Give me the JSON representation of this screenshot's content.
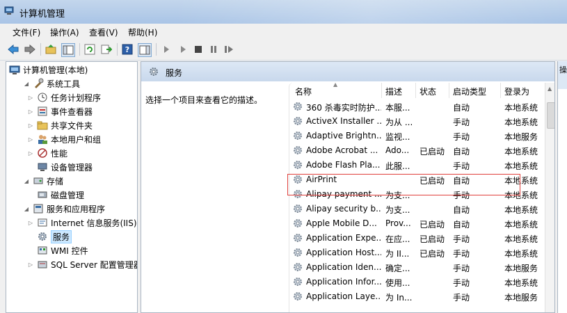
{
  "window": {
    "title": "计算机管理"
  },
  "menu": [
    "文件(F)",
    "操作(A)",
    "查看(V)",
    "帮助(H)"
  ],
  "tree": [
    {
      "label": "计算机管理(本地)",
      "level": 0,
      "expander": ""
    },
    {
      "label": "系统工具",
      "level": 1,
      "expander": "◢"
    },
    {
      "label": "任务计划程序",
      "level": 2,
      "expander": "▷"
    },
    {
      "label": "事件查看器",
      "level": 2,
      "expander": "▷"
    },
    {
      "label": "共享文件夹",
      "level": 2,
      "expander": "▷"
    },
    {
      "label": "本地用户和组",
      "level": 2,
      "expander": "▷"
    },
    {
      "label": "性能",
      "level": 2,
      "expander": "▷"
    },
    {
      "label": "设备管理器",
      "level": 2,
      "expander": ""
    },
    {
      "label": "存储",
      "level": 1,
      "expander": "◢"
    },
    {
      "label": "磁盘管理",
      "level": 2,
      "expander": ""
    },
    {
      "label": "服务和应用程序",
      "level": 1,
      "expander": "◢"
    },
    {
      "label": "Internet 信息服务(IIS)管",
      "level": 2,
      "expander": "▷"
    },
    {
      "label": "服务",
      "level": 2,
      "expander": "",
      "selected": true
    },
    {
      "label": "WMI 控件",
      "level": 2,
      "expander": ""
    },
    {
      "label": "SQL Server 配置管理器",
      "level": 2,
      "expander": "▷"
    }
  ],
  "main": {
    "header_title": "服务",
    "description": "选择一个项目来查看它的描述。",
    "columns": [
      "名称",
      "描述",
      "状态",
      "启动类型",
      "登录为"
    ],
    "rows": [
      [
        "360 杀毒实时防护...",
        "本服...",
        "",
        "自动",
        "本地系统"
      ],
      [
        "ActiveX Installer ...",
        "为从 ...",
        "",
        "手动",
        "本地系统"
      ],
      [
        "Adaptive Brightn...",
        "监视...",
        "",
        "手动",
        "本地服务"
      ],
      [
        "Adobe Acrobat ...",
        "Ado...",
        "已启动",
        "自动",
        "本地系统"
      ],
      [
        "Adobe Flash Pla...",
        "此服...",
        "",
        "手动",
        "本地系统"
      ],
      [
        "AirPrint",
        "",
        "已启动",
        "自动",
        "本地系统"
      ],
      [
        "Alipay payment ...",
        "为支...",
        "",
        "手动",
        "本地系统"
      ],
      [
        "Alipay security b...",
        "为支...",
        "",
        "自动",
        "本地系统"
      ],
      [
        "Apple Mobile D...",
        "Prov...",
        "已启动",
        "自动",
        "本地系统"
      ],
      [
        "Application Expe...",
        "在应...",
        "已启动",
        "手动",
        "本地系统"
      ],
      [
        "Application Host...",
        "为 II...",
        "已启动",
        "手动",
        "本地系统"
      ],
      [
        "Application Iden...",
        "确定...",
        "",
        "手动",
        "本地服务"
      ],
      [
        "Application Infor...",
        "使用...",
        "",
        "手动",
        "本地系统"
      ],
      [
        "Application Laye...",
        "为 In...",
        "",
        "手动",
        "本地服务"
      ]
    ]
  },
  "right_pane": {
    "header": "操"
  },
  "colors": {
    "highlight_box": "#e0403c",
    "selection": "#cce8ff"
  }
}
